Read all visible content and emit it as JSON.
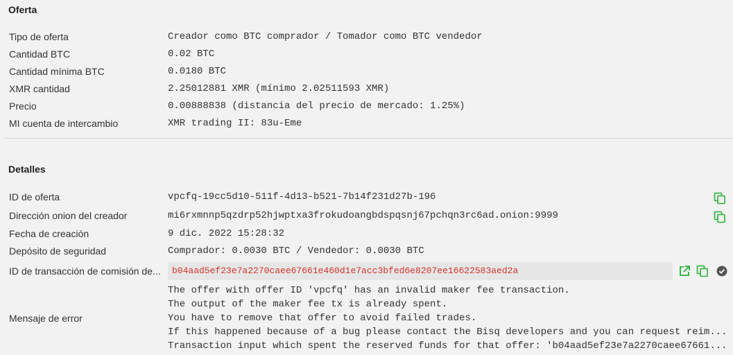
{
  "offer_section": {
    "title": "Oferta",
    "rows": [
      {
        "label": "Tipo de oferta",
        "value": "Creador como BTC comprador / Tomador como BTC vendedor"
      },
      {
        "label": "Cantidad BTC",
        "value": "0.02 BTC"
      },
      {
        "label": "Cantidad mínima BTC",
        "value": "0.0180 BTC"
      },
      {
        "label": "XMR cantidad",
        "value": "2.25012881 XMR (mínimo 2.02511593 XMR)"
      },
      {
        "label": "Precio",
        "value": "0.00888838 (distancia del precio de mercado: 1.25%)"
      },
      {
        "label": "MI cuenta de intercambio",
        "value": "XMR trading II: 83u-Eme"
      }
    ]
  },
  "details_section": {
    "title": "Detalles",
    "offer_id": {
      "label": "ID de oferta",
      "value": "vpcfq-19cc5d10-511f-4d13-b521-7b14f231d27b-196"
    },
    "onion_address": {
      "label": "Dirección onion del creador",
      "value": "mi6rxmnnp5qzdrp52hjwptxa3frokudoangbdspqsnj67pchqn3rc6ad.onion:9999"
    },
    "creation_date": {
      "label": "Fecha de creación",
      "value": "9 dic. 2022 15:28:32"
    },
    "security_deposit": {
      "label": "Depósito de seguridad",
      "value": "Comprador: 0.0030 BTC / Vendedor: 0.0030 BTC"
    },
    "fee_tx": {
      "label": "ID de transacción de comisión de...",
      "value": "b04aad5ef23e7a2270caee67661e460d1e7acc3bfed6e8207ee16622583aed2a"
    },
    "error": {
      "label": "Mensaje de error",
      "lines": [
        "The offer with offer ID 'vpcfq' has an invalid maker fee transaction.",
        "The output of the maker fee tx is already spent.",
        "You have to remove that offer to avoid failed trades.",
        "If this happened because of a bug please contact the Bisq developers and you can request reim...",
        "Transaction input which spent the reserved funds for that offer: 'b04aad5ef23e7a2270caee67661..."
      ]
    }
  },
  "icons": {
    "copy": "copy-icon",
    "open_external": "external-link-icon",
    "confirmed": "check-circle-icon"
  },
  "colors": {
    "icon_green": "#25b135",
    "error_text": "#d0352b",
    "check_dark": "#555555"
  }
}
